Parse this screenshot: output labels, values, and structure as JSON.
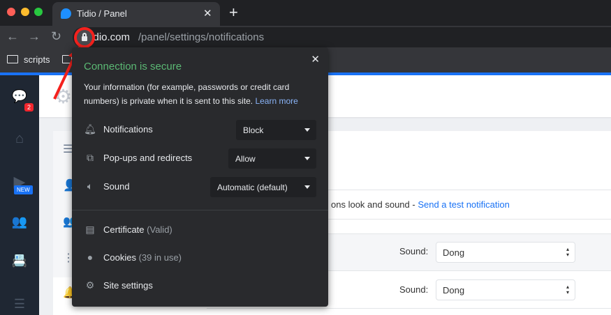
{
  "browser": {
    "tab_title": "Tidio / Panel",
    "url_domain": "tidio.com",
    "url_path": "/panel/settings/notifications",
    "bookmarks": [
      "scripts"
    ]
  },
  "sidebar": {
    "chat_badge": "2",
    "new_badge": "NEW"
  },
  "main": {
    "description_partial": "ons look and sound - ",
    "test_link": "Send a test notification",
    "sound_label": "Sound:",
    "sound_rows": [
      "Dong",
      "Dong"
    ]
  },
  "popup": {
    "title": "Connection is secure",
    "body": "Your information (for example, passwords or credit card numbers) is private when it is sent to this site.",
    "learn_more": "Learn more",
    "permissions": [
      {
        "label": "Notifications",
        "value": "Block"
      },
      {
        "label": "Pop-ups and redirects",
        "value": "Allow"
      },
      {
        "label": "Sound",
        "value": "Automatic (default)"
      }
    ],
    "certificate": "Certificate",
    "certificate_status": "(Valid)",
    "cookies": "Cookies",
    "cookies_status": "(39 in use)",
    "site_settings": "Site settings"
  },
  "colors": {
    "secure_green": "#5bb974",
    "link_blue": "#8ab4f8",
    "annotation_red": "#f4211d"
  }
}
